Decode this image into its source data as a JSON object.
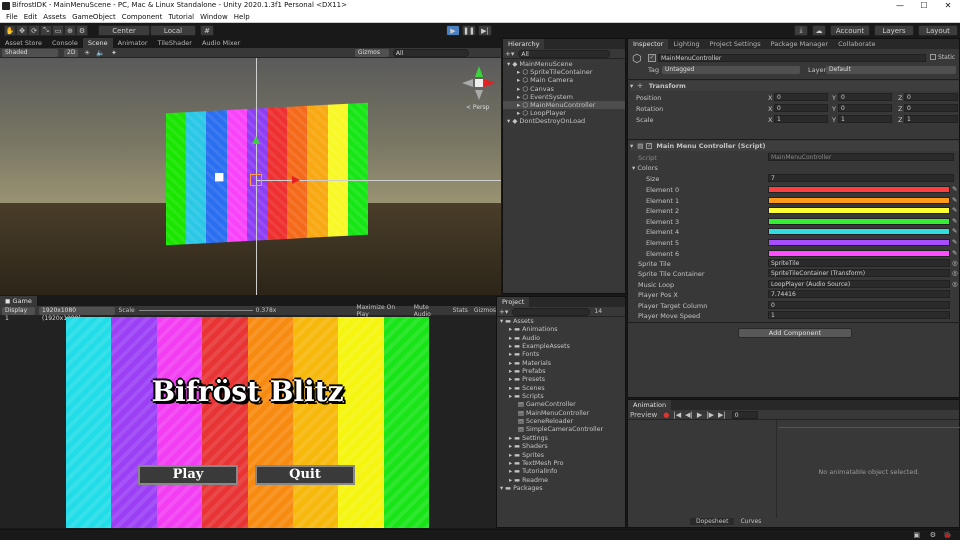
{
  "window": {
    "title": "BifrostIDK - MainMenuScene - PC, Mac & Linux Standalone - Unity 2020.1.3f1 Personal <DX11>",
    "minimize": "—",
    "maximize": "☐",
    "close": "✕"
  },
  "menu": [
    "File",
    "Edit",
    "Assets",
    "GameObject",
    "Component",
    "Tutorial",
    "Window",
    "Help"
  ],
  "toolbar": {
    "pivot": "Center",
    "space": "Local",
    "account": "Account",
    "layers": "Layers",
    "layout": "Layout"
  },
  "scene_tabs": [
    "Asset Store",
    "Console",
    "Scene",
    "Animator",
    "TileShader",
    "Audio Mixer"
  ],
  "scene_toolbar": {
    "shading": "Shaded",
    "mode2d": "2D",
    "gizmos": "Gizmos",
    "search": "All",
    "persp": "< Persp"
  },
  "game_tab": "Game",
  "game_toolbar": {
    "display": "Display 1",
    "resolution": "1920x1080 (1920x1080)",
    "scale_label": "Scale",
    "scale_value": "0.378x",
    "maximize": "Maximize On Play",
    "mute": "Mute Audio",
    "stats": "Stats",
    "gizmos": "Gizmos"
  },
  "game": {
    "title": "Bifröst Blitz",
    "play": "Play",
    "quit": "Quit"
  },
  "hierarchy": {
    "tab": "Hierarchy",
    "search": "All",
    "items": [
      {
        "label": "MainMenuScene",
        "depth": 0
      },
      {
        "label": "SpriteTileContainer",
        "depth": 1
      },
      {
        "label": "Main Camera",
        "depth": 1
      },
      {
        "label": "Canvas",
        "depth": 1
      },
      {
        "label": "EventSystem",
        "depth": 1
      },
      {
        "label": "MainMenuController",
        "depth": 1
      },
      {
        "label": "LoopPlayer",
        "depth": 1
      },
      {
        "label": "DontDestroyOnLoad",
        "depth": 0
      }
    ]
  },
  "project": {
    "tab": "Project",
    "count": "14",
    "items": [
      {
        "label": "Assets",
        "depth": 0
      },
      {
        "label": "Animations",
        "depth": 1
      },
      {
        "label": "Audio",
        "depth": 1
      },
      {
        "label": "ExampleAssets",
        "depth": 1
      },
      {
        "label": "Fonts",
        "depth": 1
      },
      {
        "label": "Materials",
        "depth": 1
      },
      {
        "label": "Prefabs",
        "depth": 1
      },
      {
        "label": "Presets",
        "depth": 1
      },
      {
        "label": "Scenes",
        "depth": 1
      },
      {
        "label": "Scripts",
        "depth": 1
      },
      {
        "label": "GameController",
        "depth": 2
      },
      {
        "label": "MainMenuController",
        "depth": 2
      },
      {
        "label": "SceneReloader",
        "depth": 2
      },
      {
        "label": "SimpleCameraController",
        "depth": 2
      },
      {
        "label": "Settings",
        "depth": 1
      },
      {
        "label": "Shaders",
        "depth": 1
      },
      {
        "label": "Sprites",
        "depth": 1
      },
      {
        "label": "TextMesh Pro",
        "depth": 1
      },
      {
        "label": "TutorialInfo",
        "depth": 1
      },
      {
        "label": "Readme",
        "depth": 1
      },
      {
        "label": "Packages",
        "depth": 0
      }
    ]
  },
  "inspector": {
    "tabs": [
      "Inspector",
      "Lighting",
      "Project Settings",
      "Package Manager",
      "Collaborate"
    ],
    "object_name": "MainMenuController",
    "static": "Static",
    "tag_label": "Tag",
    "tag_value": "Untagged",
    "layer_label": "Layer",
    "layer_value": "Default",
    "transform": {
      "title": "Transform",
      "rows": [
        {
          "label": "Position",
          "x": "0",
          "y": "0",
          "z": "0"
        },
        {
          "label": "Rotation",
          "x": "0",
          "y": "0",
          "z": "0"
        },
        {
          "label": "Scale",
          "x": "1",
          "y": "1",
          "z": "1"
        }
      ]
    },
    "script": {
      "title": "Main Menu Controller (Script)",
      "script_label": "Script",
      "script_value": "MainMenuController",
      "colors_label": "Colors",
      "size_label": "Size",
      "size_value": "7",
      "elements": [
        "Element 0",
        "Element 1",
        "Element 2",
        "Element 3",
        "Element 4",
        "Element 5",
        "Element 6"
      ],
      "fields": [
        {
          "label": "Sprite Tile",
          "value": "SpriteTile"
        },
        {
          "label": "Sprite Tile Container",
          "value": "SpriteTileContainer (Transform)"
        },
        {
          "label": "Music Loop",
          "value": "LoopPlayer (Audio Source)"
        },
        {
          "label": "Player Pos X",
          "value": "7.74416"
        },
        {
          "label": "Player Target Column",
          "value": "0"
        },
        {
          "label": "Player Move Speed",
          "value": "1"
        }
      ]
    },
    "add_component": "Add Component"
  },
  "animation": {
    "tab": "Animation",
    "preview": "Preview",
    "time": "0",
    "empty": "No animatable object selected.",
    "dopesheet": "Dopesheet",
    "curves": "Curves"
  },
  "palette": [
    "#ff3f3f",
    "#ff9a1a",
    "#ffff33",
    "#33ee33",
    "#33dddd",
    "#a64dff",
    "#ff4dff"
  ],
  "tile_colors": [
    "#19e500",
    "#2bc8e6",
    "#2a6ff0",
    "#f844f8",
    "#8e3ff3",
    "#ee3030",
    "#f46a1a",
    "#f8a812",
    "#f8f826",
    "#16e616"
  ],
  "game_colors": [
    "#22dde8",
    "#9b40f5",
    "#f23df2",
    "#e83434",
    "#f78a10",
    "#f7b80c",
    "#f5f50f",
    "#18e418"
  ]
}
